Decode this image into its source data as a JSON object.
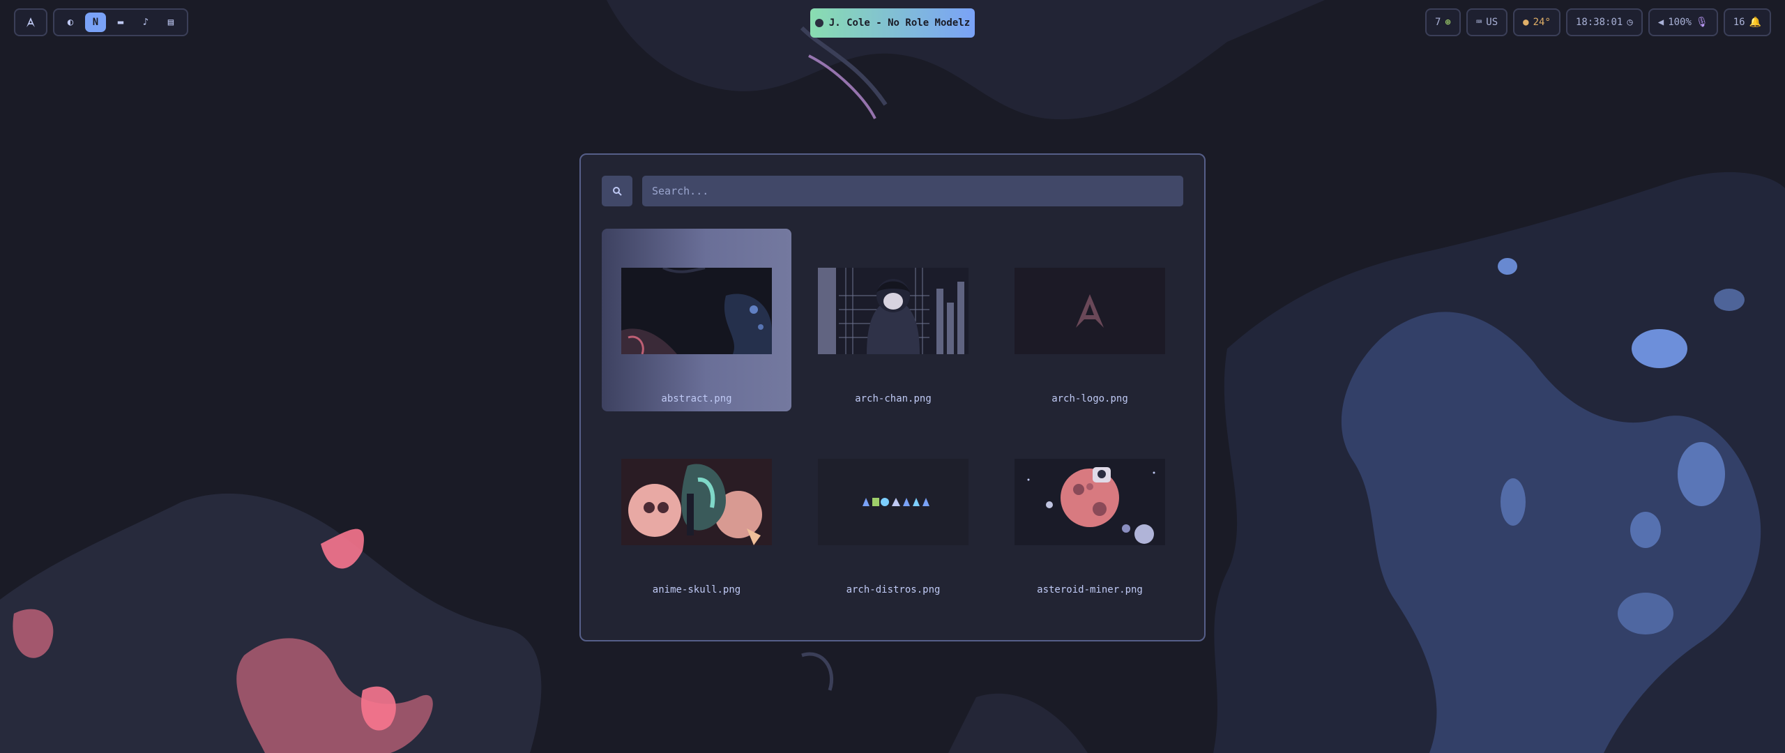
{
  "top_bar": {
    "launcher_icon": "arch-logo-icon",
    "workspaces": [
      {
        "icon": "globe-icon",
        "glyph": "◐"
      },
      {
        "icon": "neovim-icon",
        "glyph": "N",
        "active": true
      },
      {
        "icon": "folder-icon",
        "glyph": "▬"
      },
      {
        "icon": "music-icon",
        "glyph": "♪"
      },
      {
        "icon": "document-icon",
        "glyph": "▤"
      }
    ],
    "media": {
      "title": "J. Cole - No Role Modelz"
    },
    "updates": {
      "count": "7"
    },
    "keyboard": {
      "layout": "US"
    },
    "weather": {
      "temp": "24°"
    },
    "clock": {
      "time": "18:38:01"
    },
    "volume": {
      "level": "100%"
    },
    "notifications": {
      "count": "16"
    }
  },
  "picker": {
    "search": {
      "placeholder": "Search...",
      "value": ""
    },
    "items": [
      {
        "name": "abstract.png",
        "selected": true
      },
      {
        "name": "arch-chan.png"
      },
      {
        "name": "arch-logo.png"
      },
      {
        "name": "anime-skull.png"
      },
      {
        "name": "arch-distros.png"
      },
      {
        "name": "asteroid-miner.png"
      }
    ]
  },
  "colors": {
    "background": "#1a1b26",
    "accent_blue": "#7aa2f7",
    "accent_pink": "#f7768e",
    "panel": "#222434",
    "selection": "#6a6f98"
  }
}
